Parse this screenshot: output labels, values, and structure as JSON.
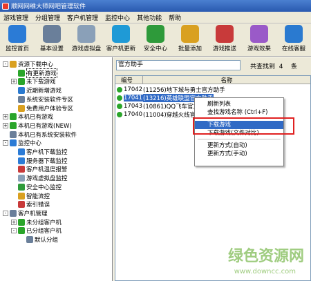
{
  "window": {
    "title": "顺网网维大师网吧管理软件"
  },
  "menu": [
    "游戏管理",
    "分组管理",
    "客户机管理",
    "监控中心",
    "其他功能",
    "帮助"
  ],
  "toolbar": [
    {
      "label": "监控首页",
      "icon": "monitor-home-icon",
      "color": "#2b7bd6"
    },
    {
      "label": "基本设置",
      "icon": "gear-icon",
      "color": "#6a7f9a"
    },
    {
      "label": "游戏虚拟盘",
      "icon": "virtual-disk-icon",
      "color": "#8aa0b8"
    },
    {
      "label": "客户机更新",
      "icon": "update-icon",
      "color": "#1f9ad6"
    },
    {
      "label": "安全中心",
      "icon": "shield-icon",
      "color": "#2e9a3a"
    },
    {
      "label": "批量添加",
      "icon": "batch-add-icon",
      "color": "#d9a020"
    },
    {
      "label": "游戏推送",
      "icon": "push-icon",
      "color": "#c83a3a"
    },
    {
      "label": "游戏效果",
      "icon": "gamepad-icon",
      "color": "#9a5ac8"
    },
    {
      "label": "在线客服",
      "icon": "support-icon",
      "color": "#2a7ad0"
    }
  ],
  "tree": [
    {
      "label": "资源下载中心",
      "level": 0,
      "exp": "-",
      "color": "#d9a020"
    },
    {
      "label": "有更新游戏",
      "level": 1,
      "exp": "",
      "color": "#2aa52a",
      "selected": true
    },
    {
      "label": "未下载游戏",
      "level": 1,
      "exp": "+",
      "color": "#2aa52a"
    },
    {
      "label": "近期新增游戏",
      "level": 1,
      "exp": "",
      "color": "#2a7ad0"
    },
    {
      "label": "系统安装软件专区",
      "level": 1,
      "exp": "",
      "color": "#6a7f9a"
    },
    {
      "label": "免费用户体验专区",
      "level": 1,
      "exp": "",
      "color": "#d9a020"
    },
    {
      "label": "本机已有游戏",
      "level": 0,
      "exp": "+",
      "color": "#2aa52a"
    },
    {
      "label": "本机已有游戏(NEW)",
      "level": 0,
      "exp": "+",
      "color": "#2aa52a"
    },
    {
      "label": "本机已有系统安装软件",
      "level": 0,
      "exp": "",
      "color": "#6a7f9a"
    },
    {
      "label": "监控中心",
      "level": 0,
      "exp": "-",
      "color": "#2b7bd6"
    },
    {
      "label": "客户机下载监控",
      "level": 1,
      "exp": "",
      "color": "#2b7bd6"
    },
    {
      "label": "服务器下载监控",
      "level": 1,
      "exp": "",
      "color": "#2b7bd6"
    },
    {
      "label": "客户机温度报警",
      "level": 1,
      "exp": "",
      "color": "#c83a3a"
    },
    {
      "label": "游戏虚拟盘监控",
      "level": 1,
      "exp": "",
      "color": "#8aa0b8"
    },
    {
      "label": "安全中心监控",
      "level": 1,
      "exp": "",
      "color": "#2e9a3a"
    },
    {
      "label": "智能流控",
      "level": 1,
      "exp": "",
      "color": "#d9a020"
    },
    {
      "label": "索引错误",
      "level": 1,
      "exp": "",
      "color": "#c83a3a"
    },
    {
      "label": "客户机管理",
      "level": 0,
      "exp": "-",
      "color": "#6a7f9a"
    },
    {
      "label": "未分组客户机",
      "level": 1,
      "exp": "+",
      "color": "#2aa52a"
    },
    {
      "label": "已分组客户机",
      "level": 1,
      "exp": "-",
      "color": "#2aa52a"
    },
    {
      "label": "默认分组",
      "level": 2,
      "exp": "",
      "color": "#6a7f9a"
    }
  ],
  "search": {
    "value": "官方助手"
  },
  "found": {
    "text": "共查找到",
    "count": "4",
    "unit": "条"
  },
  "grid": {
    "headers": {
      "id": "编号",
      "name": "名称"
    },
    "rows": [
      {
        "id": "17042",
        "name": "(11256)地下城与勇士官方助手"
      },
      {
        "id": "17041",
        "name": "(13216)英雄联盟官方助手",
        "selected": true
      },
      {
        "id": "17043",
        "name": "(10861)QQ飞车官方"
      },
      {
        "id": "17040",
        "name": "(11004)穿越火线官"
      }
    ]
  },
  "context_menu": [
    {
      "label": "刷新列表",
      "type": "item"
    },
    {
      "label": "查找游戏名称 (Ctrl+F)",
      "type": "item"
    },
    {
      "type": "sep"
    },
    {
      "label": "下载游戏",
      "type": "item",
      "highlight": true
    },
    {
      "label": "下载游戏(文件对比)",
      "type": "item"
    },
    {
      "type": "sep"
    },
    {
      "label": "更新方式(自动)",
      "type": "item"
    },
    {
      "label": "更新方式(手动)",
      "type": "item"
    }
  ],
  "watermark": {
    "main": "绿色资源网",
    "url": "www.downcc.com"
  }
}
